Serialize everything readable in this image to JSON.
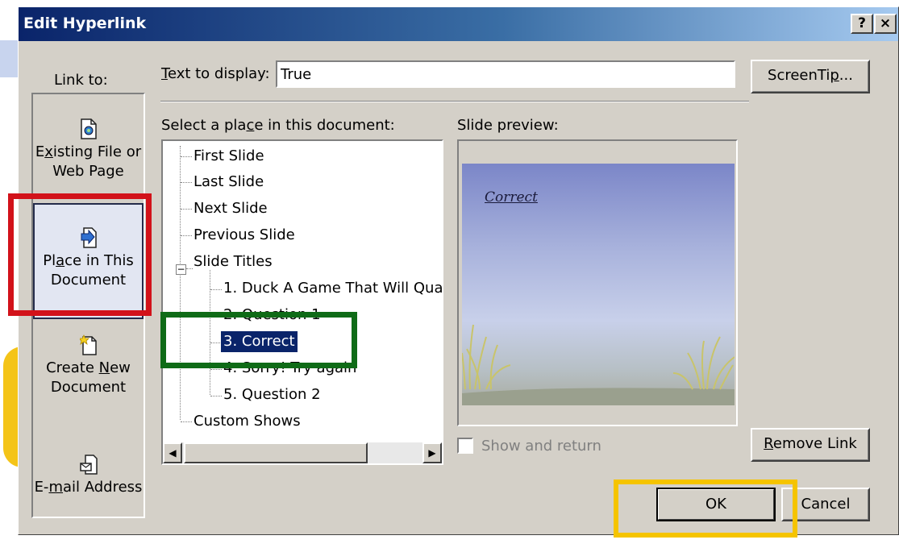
{
  "dialog": {
    "title": "Edit Hyperlink",
    "help_button": "?",
    "close_button": "×"
  },
  "link_to": {
    "label": "Link to:",
    "items": [
      {
        "line1": "Existing File or",
        "line2": "Web Page",
        "icon": "existing-file-icon",
        "selected": false
      },
      {
        "line1": "Place in This",
        "line2": "Document",
        "icon": "place-in-document-icon",
        "selected": true
      },
      {
        "line1": "Create New",
        "line2": "Document",
        "icon": "new-document-icon",
        "selected": false
      },
      {
        "line1": "E-mail Address",
        "line2": "",
        "icon": "email-icon",
        "selected": false
      }
    ]
  },
  "text_to_display": {
    "label": "Text to display:",
    "value": "True"
  },
  "screentip_button": "ScreenTip...",
  "place_list": {
    "label": "Select a place in this document:",
    "items": [
      {
        "text": "First Slide",
        "level": 0
      },
      {
        "text": "Last Slide",
        "level": 0
      },
      {
        "text": "Next Slide",
        "level": 0
      },
      {
        "text": "Previous Slide",
        "level": 0
      },
      {
        "text": "Slide Titles",
        "level": 0,
        "expanded": true
      },
      {
        "text": "1. Duck A Game That Will Quac",
        "level": 1
      },
      {
        "text": "2. Question 1",
        "level": 1
      },
      {
        "text": "3. Correct",
        "level": 1,
        "selected": true
      },
      {
        "text": "4. Sorry! Try again",
        "level": 1
      },
      {
        "text": "5. Question 2",
        "level": 1
      },
      {
        "text": "Custom Shows",
        "level": 0
      }
    ]
  },
  "slide_preview": {
    "label": "Slide preview:",
    "slide_text": "Correct"
  },
  "show_and_return": {
    "label": "Show and return",
    "checked": false,
    "enabled": false
  },
  "buttons": {
    "remove_link": "Remove Link",
    "ok": "OK",
    "cancel": "Cancel"
  },
  "highlight_colors": {
    "red": "#d2121a",
    "green": "#0f6b17",
    "yellow": "#f5c400"
  }
}
